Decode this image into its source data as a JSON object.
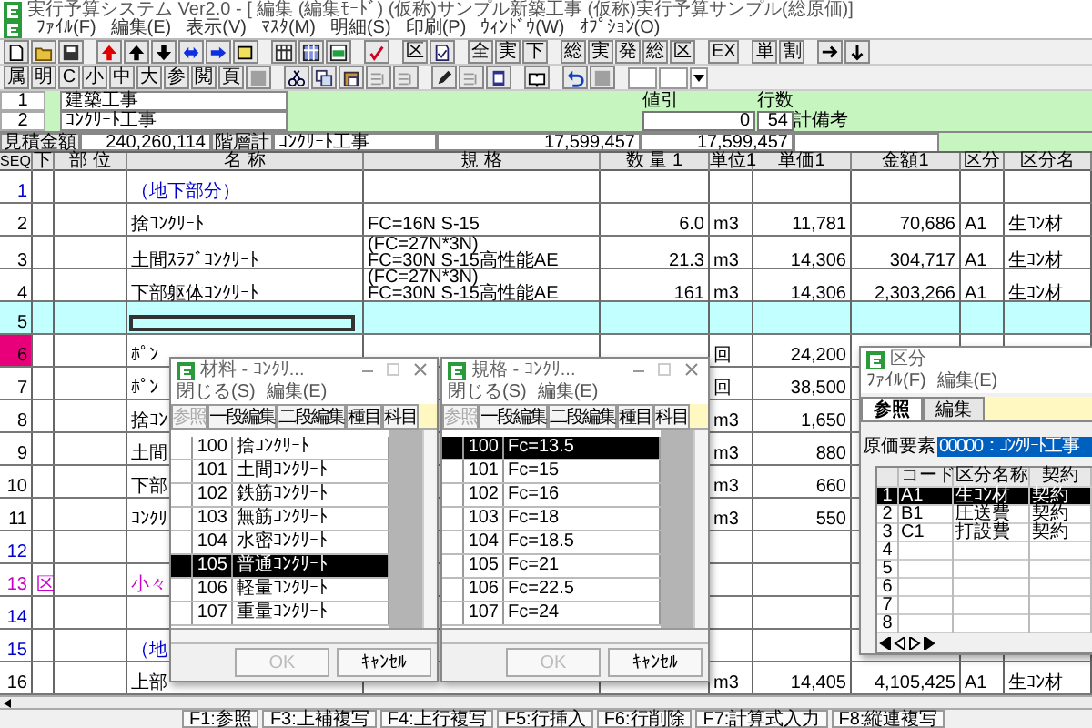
{
  "window": {
    "title": "実行予算システム Ver2.0 - [ 編集 (編集ﾓｰﾄﾞ) (仮称)サンプル新築工事 (仮称)実行予算サンプル(総原価)]"
  },
  "menu": [
    "ﾌｧｲﾙ(F)",
    "編集(E)",
    "表示(V)",
    "ﾏｽﾀ(M)",
    "明細(S)",
    "印刷(P)",
    "ｳｨﾝﾄﾞｳ(W)",
    "ｵﾌﾟｼｮﾝ(O)"
  ],
  "toolbar_1": [
    {
      "kind": "icon"
    },
    {
      "kind": "icon"
    },
    {
      "kind": "icon"
    },
    {
      "kind": "gap"
    },
    {
      "kind": "icon"
    },
    {
      "kind": "icon"
    },
    {
      "kind": "icon"
    },
    {
      "kind": "icon"
    },
    {
      "kind": "icon"
    },
    {
      "kind": "icon"
    },
    {
      "kind": "gap"
    },
    {
      "kind": "icon"
    },
    {
      "kind": "icon"
    },
    {
      "kind": "icon"
    },
    {
      "kind": "gap"
    },
    {
      "kind": "icon"
    },
    {
      "kind": "gap"
    },
    {
      "kind": "text",
      "label": "区"
    },
    {
      "kind": "icon"
    },
    {
      "kind": "gap"
    },
    {
      "kind": "text",
      "label": "全"
    },
    {
      "kind": "text",
      "label": "実"
    },
    {
      "kind": "text",
      "label": "下"
    },
    {
      "kind": "gap"
    },
    {
      "kind": "text",
      "label": "総"
    },
    {
      "kind": "text",
      "label": "実"
    },
    {
      "kind": "text",
      "label": "発"
    },
    {
      "kind": "text",
      "label": "総"
    },
    {
      "kind": "text",
      "label": "区"
    },
    {
      "kind": "gap"
    },
    {
      "kind": "text",
      "label": "EX"
    },
    {
      "kind": "gap"
    },
    {
      "kind": "text",
      "label": "単"
    },
    {
      "kind": "text",
      "label": "割"
    },
    {
      "kind": "gap"
    },
    {
      "kind": "icon"
    },
    {
      "kind": "icon"
    }
  ],
  "toolbar_2": [
    {
      "kind": "text",
      "label": "属"
    },
    {
      "kind": "text",
      "label": "明"
    },
    {
      "kind": "text",
      "label": "C"
    },
    {
      "kind": "text",
      "label": "小"
    },
    {
      "kind": "text",
      "label": "中"
    },
    {
      "kind": "text",
      "label": "大"
    },
    {
      "kind": "text",
      "label": "参"
    },
    {
      "kind": "text",
      "label": "閲"
    },
    {
      "kind": "text",
      "label": "頁"
    },
    {
      "kind": "icon"
    },
    {
      "kind": "gap"
    },
    {
      "kind": "icon"
    },
    {
      "kind": "icon"
    },
    {
      "kind": "icon"
    },
    {
      "kind": "icon"
    },
    {
      "kind": "icon"
    },
    {
      "kind": "gap"
    },
    {
      "kind": "icon"
    },
    {
      "kind": "icon"
    },
    {
      "kind": "icon"
    },
    {
      "kind": "gap"
    },
    {
      "kind": "icon"
    },
    {
      "kind": "gap"
    },
    {
      "kind": "icon"
    },
    {
      "kind": "icon"
    },
    {
      "kind": "gap"
    },
    {
      "kind": "field"
    },
    {
      "kind": "field"
    },
    {
      "kind": "dropdown"
    }
  ],
  "header_rows": [
    {
      "number": "1",
      "text": "建築工事"
    },
    {
      "number": "2",
      "text": "ｺﾝｸﾘｰﾄ工事"
    }
  ],
  "discount": {
    "label": "値引",
    "value": "0"
  },
  "row_count": {
    "label": "行数",
    "value": "54"
  },
  "remarks_label": "計備考",
  "summary": {
    "estimate_label": "見積金額",
    "estimate": "240,260,114",
    "level_label": "階層計",
    "level_name": "ｺﾝｸﾘｰﾄ工事",
    "amount_1": "17,599,457",
    "amount_2": "17,599,457"
  },
  "grid": {
    "columns": [
      "SEQ",
      "下",
      "部 位",
      "名 称",
      "規 格",
      "数 量 1",
      "単位1",
      "単価1",
      "金額1",
      "区分",
      "区分名"
    ],
    "rows": [
      {
        "seq": "1",
        "color": "#0000cc",
        "kind": "heading",
        "name": "（地下部分）",
        "selected": false,
        "marked": false
      },
      {
        "seq": "2",
        "color": "#000000",
        "kind": "item",
        "name": "捨ｺﾝｸﾘｰﾄ",
        "spec": [
          "FC=16N S-15"
        ],
        "qty": "6.0",
        "unit": "m3",
        "price": "11,781",
        "amount": "70,686",
        "cls": "A1",
        "cls_name": "生ｺﾝ材",
        "selected": false,
        "marked": false
      },
      {
        "seq": "3",
        "color": "#000000",
        "kind": "item",
        "name": "土間ｽﾗﾌﾞｺﾝｸﾘｰﾄ",
        "spec": [
          "(FC=27N*3N)",
          "FC=30N S-15高性能AE"
        ],
        "qty": "21.3",
        "unit": "m3",
        "price": "14,306",
        "amount": "304,717",
        "cls": "A1",
        "cls_name": "生ｺﾝ材",
        "selected": false,
        "marked": false
      },
      {
        "seq": "4",
        "color": "#000000",
        "kind": "item",
        "name": "下部躯体ｺﾝｸﾘｰﾄ",
        "spec": [
          "(FC=27N*3N)",
          "FC=30N S-15高性能AE"
        ],
        "qty": "161",
        "unit": "m3",
        "price": "14,306",
        "amount": "2,303,266",
        "cls": "A1",
        "cls_name": "生ｺﾝ材",
        "selected": false,
        "marked": false
      },
      {
        "seq": "5",
        "color": "#000000",
        "selected": true,
        "marked": false
      },
      {
        "seq": "6",
        "color": "#000000",
        "kind": "item",
        "name": "ﾎﾟﾝ",
        "unit": "回",
        "price": "24,200",
        "selected": false,
        "marked": true
      },
      {
        "seq": "7",
        "color": "#000000",
        "kind": "item",
        "name": "ﾎﾟﾝ",
        "unit": "回",
        "price": "38,500",
        "selected": false,
        "marked": false
      },
      {
        "seq": "8",
        "color": "#000000",
        "kind": "item",
        "name": "捨ｺﾝ",
        "unit": "m3",
        "price": "1,650",
        "selected": false,
        "marked": false
      },
      {
        "seq": "9",
        "color": "#000000",
        "kind": "item",
        "name": "土間",
        "unit": "m3",
        "price": "880",
        "selected": false,
        "marked": false
      },
      {
        "seq": "10",
        "color": "#000000",
        "kind": "item",
        "name": "下部",
        "unit": "m3",
        "price": "660",
        "selected": false,
        "marked": false
      },
      {
        "seq": "11",
        "color": "#000000",
        "kind": "item",
        "name": "ｺﾝｸﾘ",
        "unit": "m3",
        "price": "550",
        "selected": false,
        "marked": false
      },
      {
        "seq": "12",
        "color": "#0000cc",
        "selected": false,
        "marked": false
      },
      {
        "seq": "13",
        "color": "#cc00cc",
        "kind": "subtotal",
        "lower": "区",
        "name": "小々",
        "selected": false,
        "marked": false
      },
      {
        "seq": "14",
        "color": "#0000cc",
        "selected": false,
        "marked": false
      },
      {
        "seq": "15",
        "color": "#0000cc",
        "kind": "heading",
        "name": "（地",
        "selected": false,
        "marked": false
      },
      {
        "seq": "16",
        "color": "#000000",
        "kind": "item",
        "name": "上部",
        "unit": "m3",
        "price": "14,405",
        "amount": "4,105,425",
        "cls": "A1",
        "cls_name": "生ｺﾝ材",
        "selected": false,
        "marked": false
      }
    ]
  },
  "material_window": {
    "title": "材料 - ｺﾝｸﾘ...",
    "menu": [
      "閉じる(S)",
      "編集(E)"
    ],
    "buttons": [
      {
        "label": "参照",
        "disabled": true
      },
      {
        "label": "一段編集",
        "disabled": false
      },
      {
        "label": "二段編集",
        "disabled": false
      },
      {
        "label": "種目",
        "disabled": false
      },
      {
        "label": "科目",
        "disabled": false
      }
    ],
    "items": [
      {
        "code": "100",
        "name": "捨ｺﾝｸﾘｰﾄ",
        "selected": false
      },
      {
        "code": "101",
        "name": "土間ｺﾝｸﾘｰﾄ",
        "selected": false
      },
      {
        "code": "102",
        "name": "鉄筋ｺﾝｸﾘｰﾄ",
        "selected": false
      },
      {
        "code": "103",
        "name": "無筋ｺﾝｸﾘｰﾄ",
        "selected": false
      },
      {
        "code": "104",
        "name": "水密ｺﾝｸﾘｰﾄ",
        "selected": false
      },
      {
        "code": "105",
        "name": "普通ｺﾝｸﾘｰﾄ",
        "selected": true
      },
      {
        "code": "106",
        "name": "軽量ｺﾝｸﾘｰﾄ",
        "selected": false
      },
      {
        "code": "107",
        "name": "重量ｺﾝｸﾘｰﾄ",
        "selected": false
      }
    ],
    "ok": {
      "label": "OK",
      "disabled": true
    },
    "cancel": {
      "label": "ｷｬﾝｾﾙ",
      "disabled": false
    }
  },
  "spec_window": {
    "title": "規格 - ｺﾝｸﾘ...",
    "menu": [
      "閉じる(S)",
      "編集(E)"
    ],
    "buttons": [
      {
        "label": "参照",
        "disabled": true
      },
      {
        "label": "一段編集",
        "disabled": false
      },
      {
        "label": "二段編集",
        "disabled": false
      },
      {
        "label": "種目",
        "disabled": false
      },
      {
        "label": "科目",
        "disabled": false
      }
    ],
    "items": [
      {
        "code": "100",
        "name": "Fc=13.5",
        "selected": true
      },
      {
        "code": "101",
        "name": "Fc=15",
        "selected": false
      },
      {
        "code": "102",
        "name": "Fc=16",
        "selected": false
      },
      {
        "code": "103",
        "name": "Fc=18",
        "selected": false
      },
      {
        "code": "104",
        "name": "Fc=18.5",
        "selected": false
      },
      {
        "code": "105",
        "name": "Fc=21",
        "selected": false
      },
      {
        "code": "106",
        "name": "Fc=22.5",
        "selected": false
      },
      {
        "code": "107",
        "name": "Fc=24",
        "selected": false
      }
    ],
    "ok": {
      "label": "OK",
      "disabled": true
    },
    "cancel": {
      "label": "ｷｬﾝｾﾙ",
      "disabled": false
    }
  },
  "class_window": {
    "title": "区分",
    "menu": [
      "ﾌｧｲﾙ(F)",
      "編集(E)"
    ],
    "tabs": [
      {
        "label": "参照",
        "selected": true
      },
      {
        "label": "編集",
        "selected": false
      }
    ],
    "field": {
      "label": "原価要素",
      "value": "00000：ｺﾝｸﾘｰﾄ工事"
    },
    "columns": [
      "コード",
      "区分名称",
      "契約"
    ],
    "rows": [
      {
        "number": "1",
        "code": "A1",
        "name": "生ｺﾝ材",
        "contract": "契約",
        "selected": true
      },
      {
        "number": "2",
        "code": "B1",
        "name": "圧送費",
        "contract": "契約",
        "selected": false
      },
      {
        "number": "3",
        "code": "C1",
        "name": "打設費",
        "contract": "契約",
        "selected": false
      },
      {
        "number": "4",
        "selected": false
      },
      {
        "number": "5",
        "selected": false
      },
      {
        "number": "6",
        "selected": false
      },
      {
        "number": "7",
        "selected": false
      },
      {
        "number": "8",
        "selected": false
      }
    ]
  },
  "status_bar": [
    "F1:参照",
    "F3:上補複写",
    "F4:上行複写",
    "F5:行挿入",
    "F6:行削除",
    "F7:計算式入力",
    "F8:縦連複写"
  ]
}
